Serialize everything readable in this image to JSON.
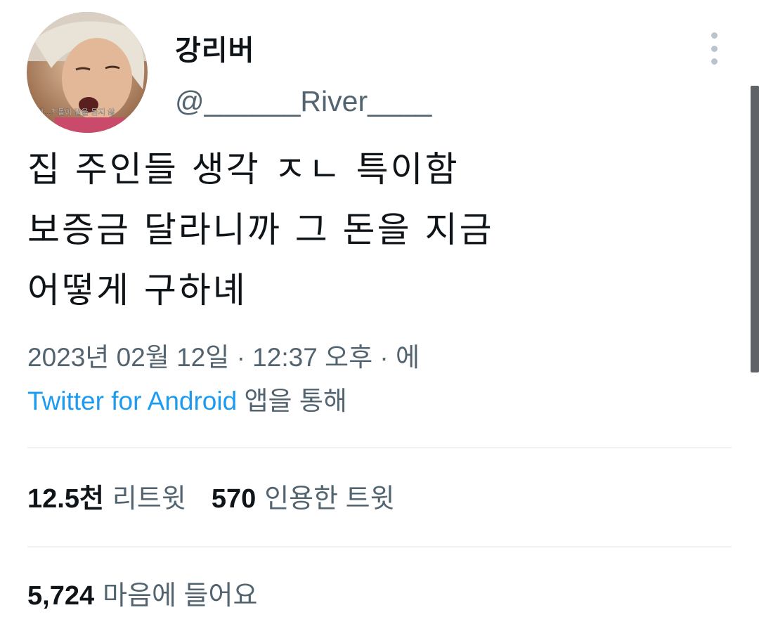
{
  "author": {
    "display_name": "강리버",
    "handle": "@______River____",
    "avatar_caption": "제...? 몸이 말을 듣지 않"
  },
  "tweet": {
    "text": "집 주인들 생각 ㅈㄴ 특이함\n보증금 달라니까 그 돈을 지금\n어떻게 구하녜",
    "timestamp": "2023년 02월 12일 · 12:37 오후 · 에",
    "source_app": "Twitter for Android",
    "source_suffix": " 앱을 통해"
  },
  "stats": {
    "retweets_count": "12.5천",
    "retweets_label": "리트윗",
    "quotes_count": "570",
    "quotes_label": "인용한 트윗",
    "likes_count": "5,724",
    "likes_label": "마음에 들어요"
  },
  "icons": {
    "more": "more-vertical-icon"
  },
  "colors": {
    "text_primary": "#0f1419",
    "text_secondary": "#536471",
    "link": "#1d9bf0",
    "divider": "#eff3f4"
  }
}
